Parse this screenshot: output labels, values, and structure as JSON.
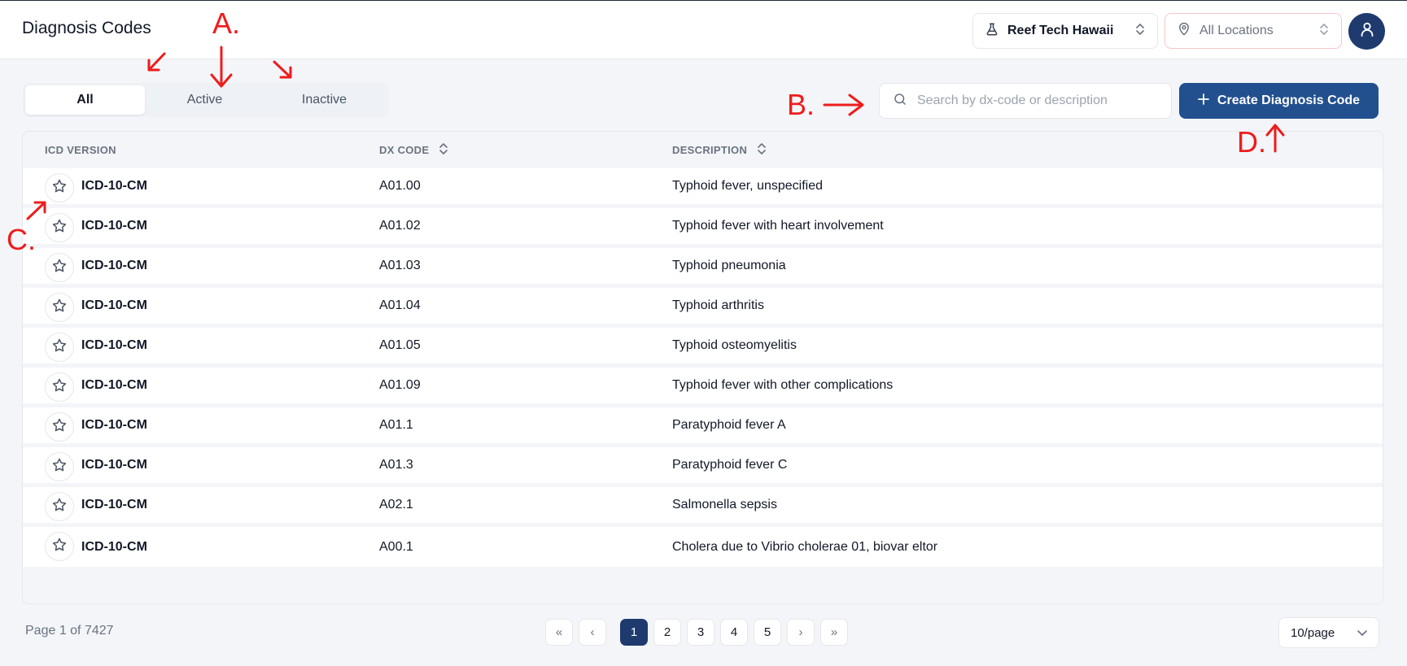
{
  "header": {
    "title": "Diagnosis Codes",
    "org_select": "Reef Tech Hawaii",
    "location_select": "All Locations"
  },
  "tabs": [
    {
      "label": "All",
      "active": true
    },
    {
      "label": "Active",
      "active": false
    },
    {
      "label": "Inactive",
      "active": false
    }
  ],
  "search": {
    "placeholder": "Search by dx-code or description",
    "value": ""
  },
  "create_button": {
    "label": "Create Diagnosis Code"
  },
  "table": {
    "columns": [
      "ICD VERSION",
      "DX CODE",
      "DESCRIPTION"
    ],
    "rows": [
      {
        "icd": "ICD-10-CM",
        "dx": "A01.00",
        "desc": "Typhoid fever, unspecified"
      },
      {
        "icd": "ICD-10-CM",
        "dx": "A01.02",
        "desc": "Typhoid fever with heart involvement"
      },
      {
        "icd": "ICD-10-CM",
        "dx": "A01.03",
        "desc": "Typhoid pneumonia"
      },
      {
        "icd": "ICD-10-CM",
        "dx": "A01.04",
        "desc": "Typhoid arthritis"
      },
      {
        "icd": "ICD-10-CM",
        "dx": "A01.05",
        "desc": "Typhoid osteomyelitis"
      },
      {
        "icd": "ICD-10-CM",
        "dx": "A01.09",
        "desc": "Typhoid fever with other complications"
      },
      {
        "icd": "ICD-10-CM",
        "dx": "A01.1",
        "desc": "Paratyphoid fever A"
      },
      {
        "icd": "ICD-10-CM",
        "dx": "A01.3",
        "desc": "Paratyphoid fever C"
      },
      {
        "icd": "ICD-10-CM",
        "dx": "A02.1",
        "desc": "Salmonella sepsis"
      },
      {
        "icd": "ICD-10-CM",
        "dx": "A00.1",
        "desc": "Cholera due to Vibrio cholerae 01, biovar eltor"
      }
    ]
  },
  "footer": {
    "page_info": "Page 1 of 7427",
    "pages": [
      "1",
      "2",
      "3",
      "4",
      "5"
    ],
    "first": "«",
    "prev": "‹",
    "next": "›",
    "last": "»",
    "per_page": "10/page"
  },
  "annotations": {
    "a": "A.",
    "b": "B.",
    "c": "C.",
    "d": "D."
  },
  "colors": {
    "accent": "#22508f",
    "avatar": "#1e3a6e",
    "annotation": "#ee1c1c"
  },
  "icons": [
    "flask-icon",
    "map-pin-icon",
    "user-icon",
    "search-icon",
    "plus-icon",
    "star-icon",
    "sort-icon",
    "chevron-down-icon"
  ]
}
